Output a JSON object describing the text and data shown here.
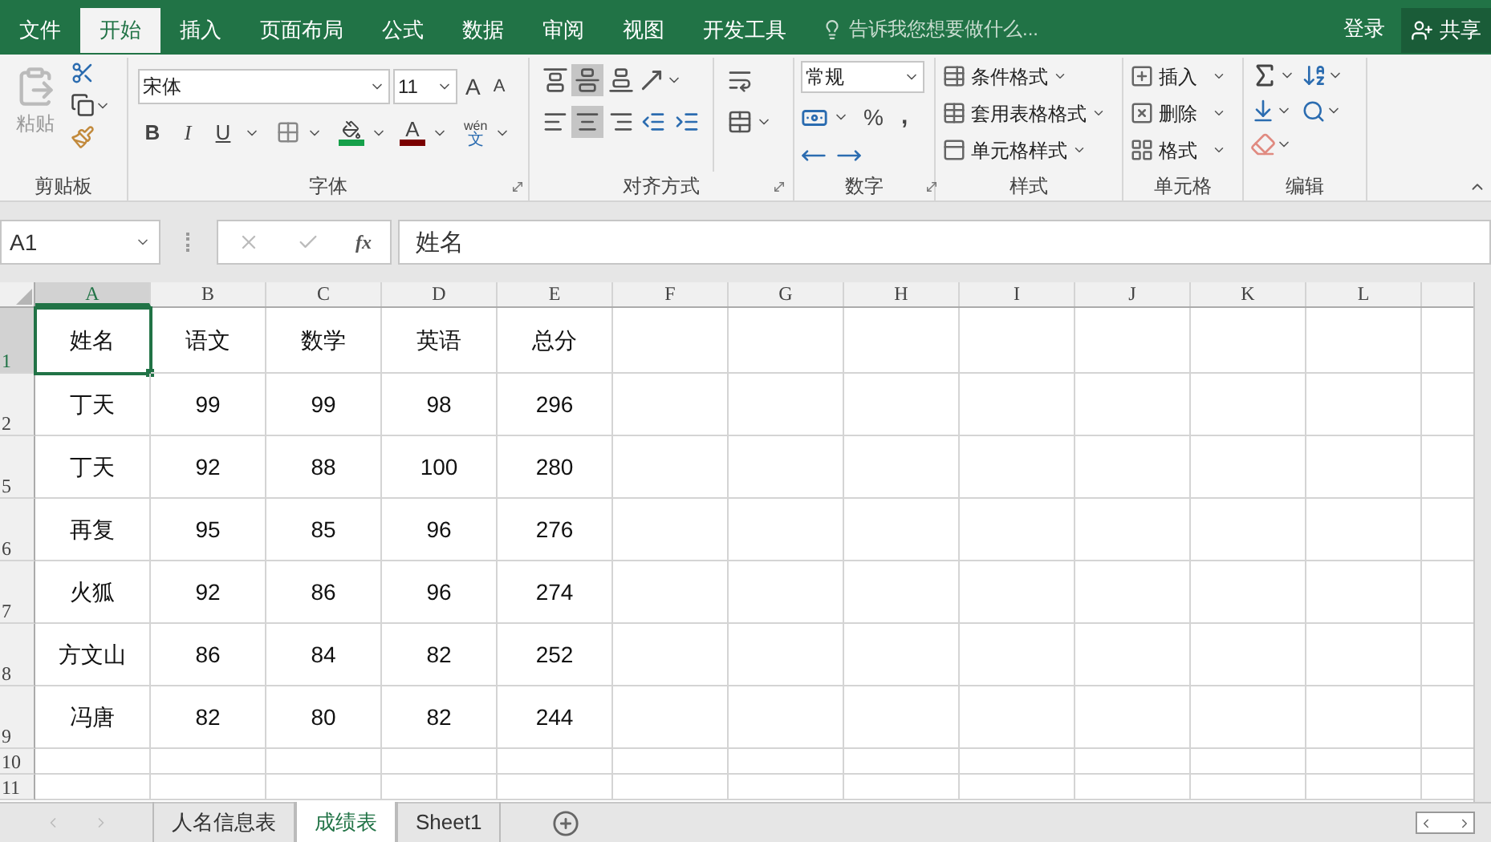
{
  "menu_tabs": [
    {
      "label": "文件",
      "selected": false
    },
    {
      "label": "开始",
      "selected": true
    },
    {
      "label": "插入",
      "selected": false
    },
    {
      "label": "页面布局",
      "selected": false
    },
    {
      "label": "公式",
      "selected": false
    },
    {
      "label": "数据",
      "selected": false
    },
    {
      "label": "审阅",
      "selected": false
    },
    {
      "label": "视图",
      "selected": false
    },
    {
      "label": "开发工具",
      "selected": false
    }
  ],
  "tell_me": {
    "placeholder": "告诉我您想要做什么..."
  },
  "sign_in": "登录",
  "share": "共享",
  "ribbon": {
    "clipboard": {
      "paste": "粘贴",
      "label": "剪贴板"
    },
    "font": {
      "font_name": "宋体",
      "font_size": "11",
      "grow": "A",
      "shrink": "A",
      "bold": "B",
      "italic": "I",
      "underline": "U",
      "font_color": "A",
      "phonetic_top": "wén",
      "phonetic_bottom": "文",
      "label": "字体"
    },
    "alignment": {
      "label": "对齐方式"
    },
    "number": {
      "format": "常规",
      "percent": "%",
      "comma": ",",
      "label": "数字"
    },
    "styles": {
      "buttons": [
        "条件格式",
        "套用表格格式",
        "单元格样式"
      ],
      "label": "样式"
    },
    "cells": {
      "buttons": [
        "插入",
        "删除",
        "格式"
      ],
      "label": "单元格"
    },
    "editing": {
      "label": "编辑"
    }
  },
  "formula_bar": {
    "name_box": "A1",
    "function_label": "fx",
    "formula": "姓名"
  },
  "sheet": {
    "columns": [
      {
        "label": "A",
        "selected": true
      },
      {
        "label": "B",
        "selected": false
      },
      {
        "label": "C",
        "selected": false
      },
      {
        "label": "D",
        "selected": false
      },
      {
        "label": "E",
        "selected": false
      },
      {
        "label": "F",
        "selected": false
      },
      {
        "label": "G",
        "selected": false
      },
      {
        "label": "H",
        "selected": false
      },
      {
        "label": "I",
        "selected": false
      },
      {
        "label": "J",
        "selected": false
      },
      {
        "label": "K",
        "selected": false
      },
      {
        "label": "L",
        "selected": false
      }
    ],
    "rows": [
      {
        "number": "1",
        "selected": true,
        "cells": [
          "姓名",
          "语文",
          "数学",
          "英语",
          "总分"
        ]
      },
      {
        "number": "2",
        "selected": false,
        "cells": [
          "丁天",
          "99",
          "99",
          "98",
          "296"
        ]
      },
      {
        "number": "5",
        "selected": false,
        "cells": [
          "丁天",
          "92",
          "88",
          "100",
          "280"
        ]
      },
      {
        "number": "6",
        "selected": false,
        "cells": [
          "再复",
          "95",
          "85",
          "96",
          "276"
        ]
      },
      {
        "number": "7",
        "selected": false,
        "cells": [
          "火狐",
          "92",
          "86",
          "96",
          "274"
        ]
      },
      {
        "number": "8",
        "selected": false,
        "cells": [
          "方文山",
          "86",
          "84",
          "82",
          "252"
        ]
      },
      {
        "number": "9",
        "selected": false,
        "cells": [
          "冯唐",
          "82",
          "80",
          "82",
          "244"
        ]
      },
      {
        "number": "10",
        "selected": false,
        "cells": []
      },
      {
        "number": "11",
        "selected": false,
        "cells": []
      }
    ]
  },
  "sheet_tabs": [
    {
      "label": "人名信息表",
      "selected": false
    },
    {
      "label": "成绩表",
      "selected": true
    },
    {
      "label": "Sheet1",
      "selected": false
    }
  ]
}
